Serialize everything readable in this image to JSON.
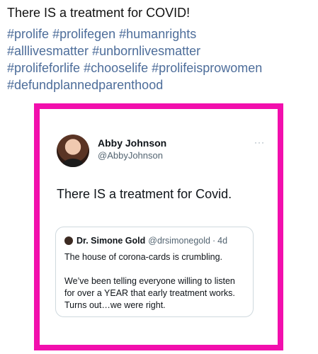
{
  "post": {
    "headline": "There IS a treatment for COVID!",
    "hashtags": [
      "#prolife",
      "#prolifegen",
      "#humanrights",
      "#alllivesmatter",
      "#unbornlivesmatter",
      "#prolifeforlife",
      "#chooselife",
      "#prolifeisprowomen",
      "#defundplannedparenthood"
    ]
  },
  "tweet": {
    "author_name": "Abby Johnson",
    "author_handle": "@AbbyJohnson",
    "more_icon": "···",
    "text": "There IS a treatment for Covid.",
    "quote": {
      "author_name": "Dr. Simone Gold",
      "author_handle": "@drsimonegold",
      "separator": "·",
      "time": "4d",
      "line1": "The house of corona-cards is crumbling.",
      "line2": "We’ve been telling everyone willing to listen for over a YEAR that early treatment works. Turns out…we were right."
    }
  },
  "colors": {
    "frame": "#f20fad",
    "hashtag": "#4d6d9a"
  }
}
